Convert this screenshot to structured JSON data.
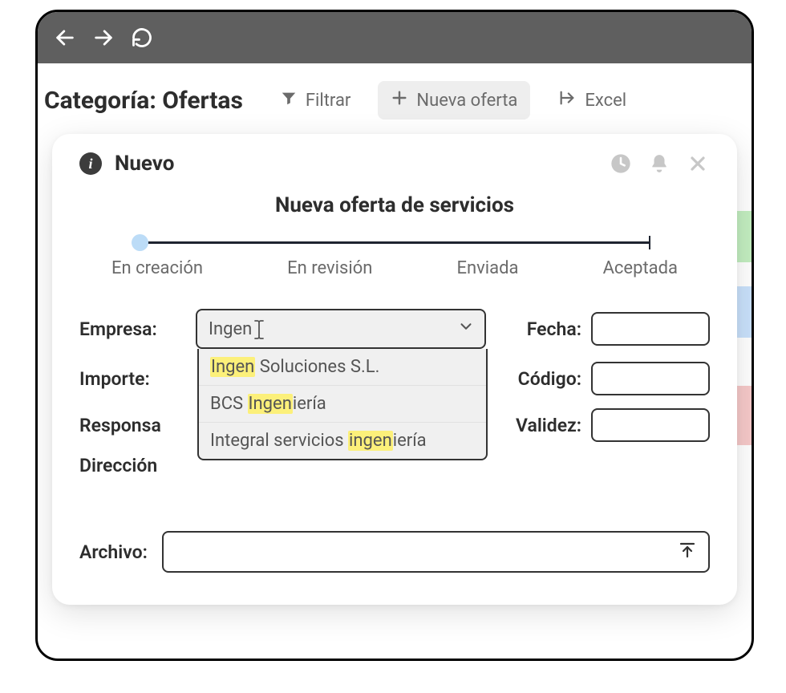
{
  "page": {
    "title": "Categoría: Ofertas"
  },
  "header": {
    "filter_label": "Filtrar",
    "new_label": "Nueva oferta",
    "excel_label": "Excel"
  },
  "modal": {
    "title": "Nuevo",
    "subtitle": "Nueva oferta de servicios"
  },
  "stepper": {
    "steps": [
      "En creación",
      "En revisión",
      "Enviada",
      "Aceptada"
    ]
  },
  "form": {
    "labels": {
      "empresa": "Empresa:",
      "importe": "Importe:",
      "responsable": "Responsa",
      "direccion": "Dirección",
      "fecha": "Fecha:",
      "codigo": "Código:",
      "validez": "Validez:",
      "archivo": "Archivo:"
    },
    "empresa_value": "Ingen"
  },
  "autocomplete": {
    "query": "Ingen",
    "options": [
      {
        "pre": "",
        "match": "Ingen",
        "post": " Soluciones S.L."
      },
      {
        "pre": "BCS ",
        "match": "Ingen",
        "post": "iería"
      },
      {
        "pre": "Integral servicios ",
        "match": "ingen",
        "post": "iería"
      }
    ]
  }
}
